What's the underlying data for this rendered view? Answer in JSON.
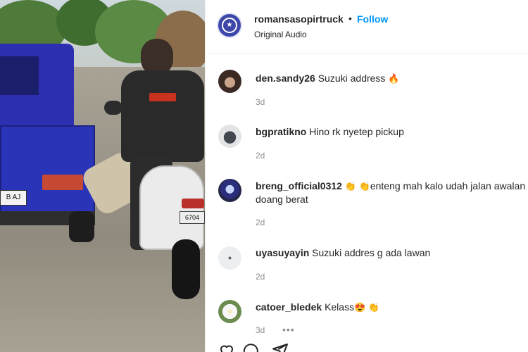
{
  "video": {
    "truck_plate": "B    AJ",
    "scooter_plate": "6704"
  },
  "header": {
    "username": "romansasopirtruck",
    "separator": "•",
    "follow_label": "Follow",
    "subtitle": "Original Audio"
  },
  "comments": [
    {
      "username": "den.sandy26",
      "text": "Suzuki address",
      "emoji": "🔥",
      "time": "3d"
    },
    {
      "username": "bgpratikno",
      "text": "Hino rk nyetep pickup",
      "time": "2d"
    },
    {
      "username": "breng_official0312",
      "emoji_pre": "👏 👏",
      "text": "enteng mah kalo udah jalan awalan doang berat",
      "time": "2d"
    },
    {
      "username": "uyasuyayin",
      "text": "Suzuki addres g ada lawan",
      "time": "2d"
    },
    {
      "username": "catoer_bledek",
      "text": "Kelass",
      "emoji": "😍 👏",
      "time": "3d",
      "more": "•••"
    }
  ],
  "icons": {
    "header_avatar": "truck-club-logo",
    "like": "heart-icon",
    "comment": "comment-icon",
    "share": "paper-plane-icon"
  },
  "colors": {
    "follow": "#0095f6",
    "secondary_text": "#8e8e8e"
  }
}
